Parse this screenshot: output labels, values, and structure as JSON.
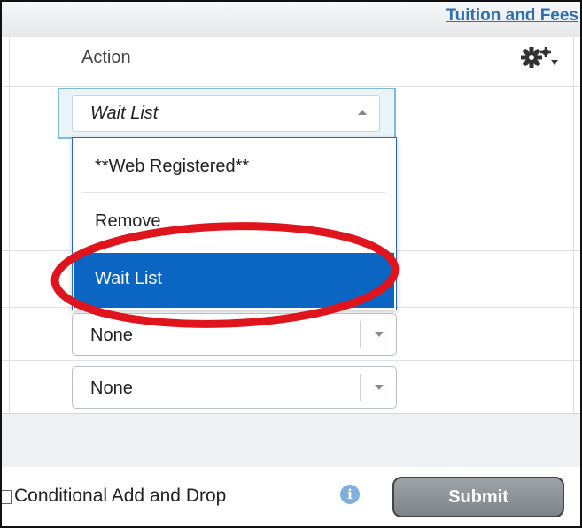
{
  "header": {
    "link_label": "Tuition and Fees"
  },
  "table": {
    "action_header": "Action",
    "settings_icon": "gear-icon",
    "open_select": {
      "value": "Wait List"
    },
    "dropdown": {
      "options": [
        {
          "label": "**Web Registered**",
          "selected": false
        },
        {
          "label": "Remove",
          "selected": false
        },
        {
          "label": "Wait List",
          "selected": true
        }
      ]
    },
    "selects": [
      {
        "value": "None"
      },
      {
        "value": "None"
      }
    ]
  },
  "footer": {
    "conditional_label": "Conditional Add and Drop",
    "info_icon": "info-icon",
    "submit_label": "Submit"
  },
  "colors": {
    "highlight": "#0a66c2",
    "link": "#2f6fb0",
    "annotation": "#e0141c"
  }
}
